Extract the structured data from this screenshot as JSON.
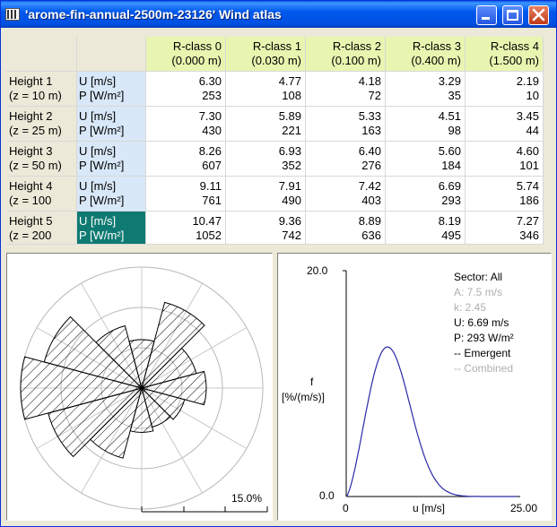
{
  "window": {
    "title": "'arome-fin-annual-2500m-23126' Wind atlas"
  },
  "table": {
    "columns": [
      {
        "name": "R-class 0",
        "value": "(0.000 m)"
      },
      {
        "name": "R-class 1",
        "value": "(0.030 m)"
      },
      {
        "name": "R-class 2",
        "value": "(0.100 m)"
      },
      {
        "name": "R-class 3",
        "value": "(0.400 m)"
      },
      {
        "name": "R-class 4",
        "value": "(1.500 m)"
      }
    ],
    "units": {
      "u": "U [m/s]",
      "p": "P [W/m²]"
    },
    "rows": [
      {
        "name": "Height 1",
        "z": "(z = 10 m)",
        "u": [
          "6.30",
          "4.77",
          "4.18",
          "3.29",
          "2.19"
        ],
        "p": [
          "253",
          "108",
          "72",
          "35",
          "10"
        ]
      },
      {
        "name": "Height 2",
        "z": "(z = 25 m)",
        "u": [
          "7.30",
          "5.89",
          "5.33",
          "4.51",
          "3.45"
        ],
        "p": [
          "430",
          "221",
          "163",
          "98",
          "44"
        ]
      },
      {
        "name": "Height 3",
        "z": "(z = 50 m)",
        "u": [
          "8.26",
          "6.93",
          "6.40",
          "5.60",
          "4.60"
        ],
        "p": [
          "607",
          "352",
          "276",
          "184",
          "101"
        ]
      },
      {
        "name": "Height 4",
        "z": "(z = 100",
        "u": [
          "9.11",
          "7.91",
          "7.42",
          "6.69",
          "5.74"
        ],
        "p": [
          "761",
          "490",
          "403",
          "293",
          "186"
        ]
      },
      {
        "name": "Height 5",
        "z": "(z = 200",
        "u": [
          "10.47",
          "9.36",
          "8.89",
          "8.19",
          "7.27"
        ],
        "p": [
          "1052",
          "742",
          "636",
          "495",
          "346"
        ]
      }
    ]
  },
  "rose": {
    "scale_label": "15.0%",
    "sector_frequencies": [
      6.0,
      11.0,
      7.0,
      8.0,
      5.5,
      5.0,
      5.5,
      9.0,
      12.0,
      15.0,
      12.5,
      8.0
    ],
    "max": 15.0
  },
  "distribution": {
    "info": {
      "sector": "Sector: All",
      "a": "A: 7.5 m/s",
      "k": "k: 2.45",
      "u": "U: 6.69 m/s",
      "p": "P: 293 W/m²",
      "emergent": "-- Emergent",
      "combined": "-- Combined"
    },
    "y_label_1": "f",
    "y_label_2": "[%/(m/s)]",
    "x_label": "u [m/s]",
    "x_min": "0",
    "x_max": "25.00",
    "y_min": "0.0",
    "y_max": "20.0",
    "line_color": "#2a2aa8"
  },
  "chart_data": {
    "type": "line",
    "xlabel": "u [m/s]",
    "ylabel": "f [%/(m/s)]",
    "xlim": [
      0,
      25
    ],
    "ylim": [
      0,
      20
    ],
    "weibull": {
      "A": 7.5,
      "k": 2.45
    },
    "x": [
      0,
      1,
      2,
      3,
      4,
      5,
      6,
      7,
      8,
      9,
      10,
      11,
      12,
      13,
      14,
      15,
      16,
      17,
      18,
      19,
      20
    ],
    "y": [
      0,
      0.9,
      3.2,
      6.4,
      9.7,
      12.2,
      13.4,
      13.1,
      11.6,
      9.2,
      6.6,
      4.3,
      2.5,
      1.3,
      0.6,
      0.26,
      0.1,
      0.03,
      0.01,
      0,
      0
    ]
  }
}
